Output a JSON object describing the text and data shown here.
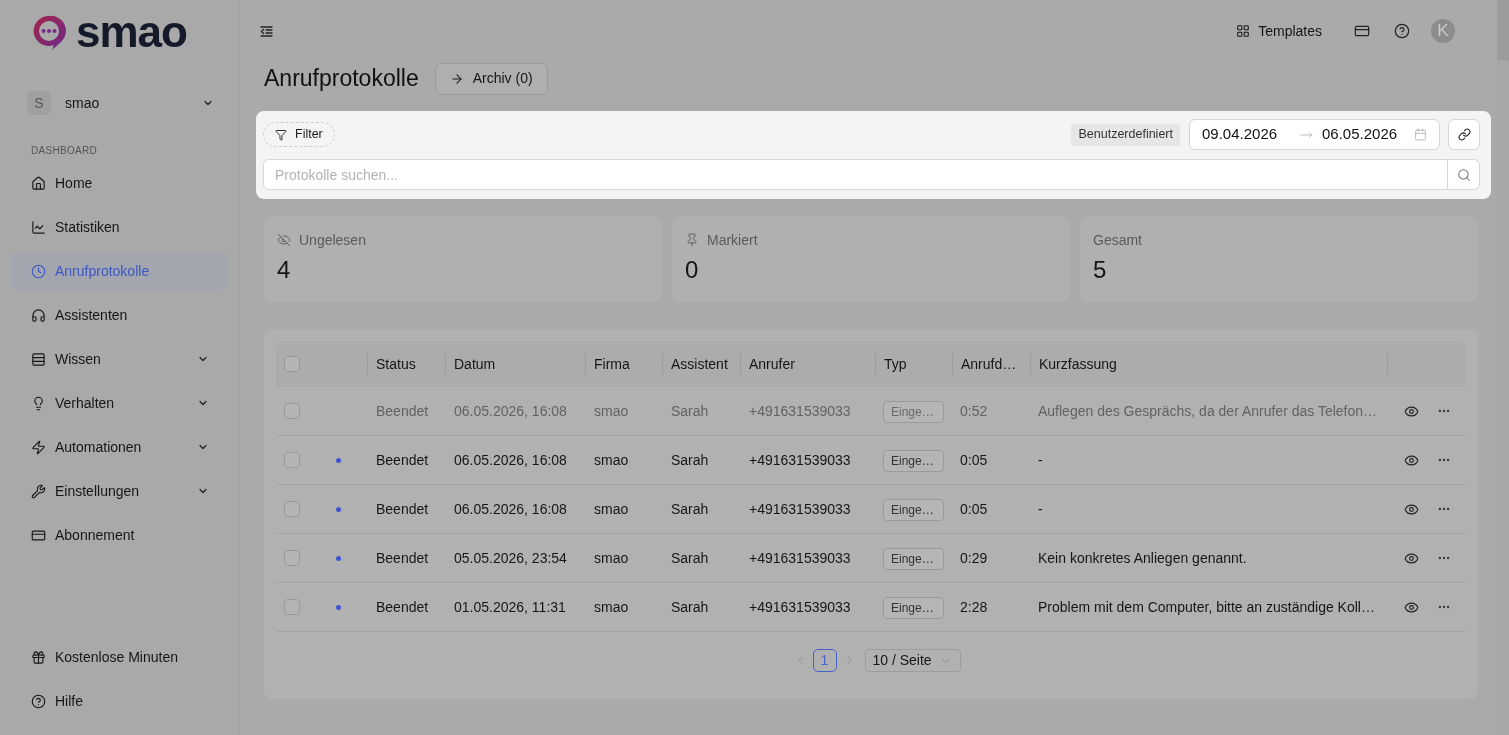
{
  "sidebar": {
    "logo": {
      "text": "smao"
    },
    "workspace": {
      "avatar": "S",
      "name": "smao"
    },
    "section_label": "DASHBOARD",
    "items": [
      {
        "label": "Home",
        "kind": "link",
        "selected": false
      },
      {
        "label": "Statistiken",
        "kind": "link",
        "selected": false
      },
      {
        "label": "Anrufprotokolle",
        "kind": "link",
        "selected": true
      },
      {
        "label": "Assistenten",
        "kind": "link",
        "selected": false
      },
      {
        "label": "Wissen",
        "kind": "group",
        "selected": false
      },
      {
        "label": "Verhalten",
        "kind": "group",
        "selected": false
      },
      {
        "label": "Automationen",
        "kind": "group",
        "selected": false
      },
      {
        "label": "Einstellungen",
        "kind": "group",
        "selected": false
      },
      {
        "label": "Abonnement",
        "kind": "link",
        "selected": false
      }
    ],
    "footer_items": [
      {
        "label": "Kostenlose Minuten"
      },
      {
        "label": "Hilfe"
      }
    ]
  },
  "topbar": {
    "templates_label": "Templates",
    "avatar": "K"
  },
  "page": {
    "title": "Anrufprotokolle",
    "archive_button": "Archiv (0)"
  },
  "filters": {
    "filter_button": "Filter",
    "preset": "Benutzerdefiniert",
    "date_from": "09.04.2026",
    "date_to": "06.05.2026",
    "search": {
      "placeholder": "Protokolle suchen..."
    }
  },
  "stats": [
    {
      "label": "Ungelesen",
      "value": "4"
    },
    {
      "label": "Markiert",
      "value": "0"
    },
    {
      "label": "Gesamt",
      "value": "5"
    }
  ],
  "table": {
    "select_all_checked": false,
    "columns": [
      "Status",
      "Datum",
      "Firma",
      "Assistent",
      "Anrufer",
      "Typ",
      "Anrufd…",
      "Kurzfassung"
    ],
    "rows": [
      {
        "checked": false,
        "unread": false,
        "status": "Beendet",
        "date": "06.05.2026, 16:08",
        "company": "smao",
        "assistant": "Sarah",
        "caller": "+491631539033",
        "type": "Einge…",
        "duration": "0:52",
        "summary": "Auflegen des Gesprächs, da der Anrufer das Telefon…"
      },
      {
        "checked": false,
        "unread": true,
        "status": "Beendet",
        "date": "06.05.2026, 16:08",
        "company": "smao",
        "assistant": "Sarah",
        "caller": "+491631539033",
        "type": "Einge…",
        "duration": "0:05",
        "summary": "-"
      },
      {
        "checked": false,
        "unread": true,
        "status": "Beendet",
        "date": "06.05.2026, 16:08",
        "company": "smao",
        "assistant": "Sarah",
        "caller": "+491631539033",
        "type": "Einge…",
        "duration": "0:05",
        "summary": "-"
      },
      {
        "checked": false,
        "unread": true,
        "status": "Beendet",
        "date": "05.05.2026, 23:54",
        "company": "smao",
        "assistant": "Sarah",
        "caller": "+491631539033",
        "type": "Einge…",
        "duration": "0:29",
        "summary": "Kein konkretes Anliegen genannt."
      },
      {
        "checked": false,
        "unread": true,
        "status": "Beendet",
        "date": "01.05.2026, 11:31",
        "company": "smao",
        "assistant": "Sarah",
        "caller": "+491631539033",
        "type": "Einge…",
        "duration": "2:28",
        "summary": "Problem mit dem Computer, bitte an zuständige Koll…"
      }
    ]
  },
  "pagination": {
    "pages": [
      {
        "label": "1",
        "selected": true
      }
    ],
    "page_size": "10 / Seite"
  }
}
